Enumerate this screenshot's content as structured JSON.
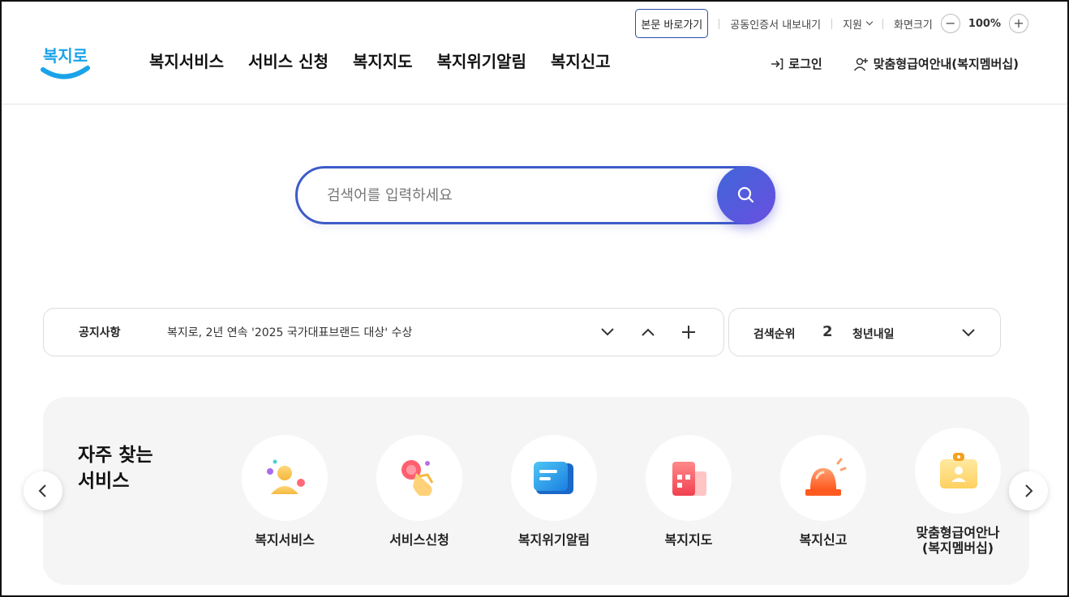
{
  "utility": {
    "skip_link": "본문 바로가기",
    "cert_export": "공동인증서 내보내기",
    "support": "지원",
    "zoom_label": "화면크기",
    "zoom_minus": "−",
    "zoom_value": "100%",
    "zoom_plus": "+"
  },
  "header": {
    "logo_text": "복지로",
    "logo_color": "#1aa3e8",
    "nav": [
      {
        "label": "복지서비스"
      },
      {
        "label": "서비스 신청"
      },
      {
        "label": "복지지도"
      },
      {
        "label": "복지위기알림"
      },
      {
        "label": "복지신고"
      }
    ],
    "login": "로그인",
    "membership": "맞춤형급여안내(복지멤버십)"
  },
  "search": {
    "placeholder": "검색어를 입력하세요",
    "accent": "#3d5bc8"
  },
  "notice": {
    "title": "공지사항",
    "text": "복지로, 2년 연속 '2025 국가대표브랜드 대상' 수상"
  },
  "ranking": {
    "title": "검색순위",
    "rank": "2",
    "keyword": "청년내일"
  },
  "frequent": {
    "title_line1": "자주 찾는",
    "title_line2": "서비스",
    "items": [
      {
        "label": "복지서비스",
        "icon": "person-icon"
      },
      {
        "label": "서비스신청",
        "icon": "hand-click-icon"
      },
      {
        "label": "복지위기알림",
        "icon": "message-icon"
      },
      {
        "label": "복지지도",
        "icon": "building-icon"
      },
      {
        "label": "복지신고",
        "icon": "siren-icon"
      },
      {
        "label": "맞춤형급여안나",
        "label2": "(복지멤버십)",
        "icon": "id-card-icon"
      }
    ]
  }
}
